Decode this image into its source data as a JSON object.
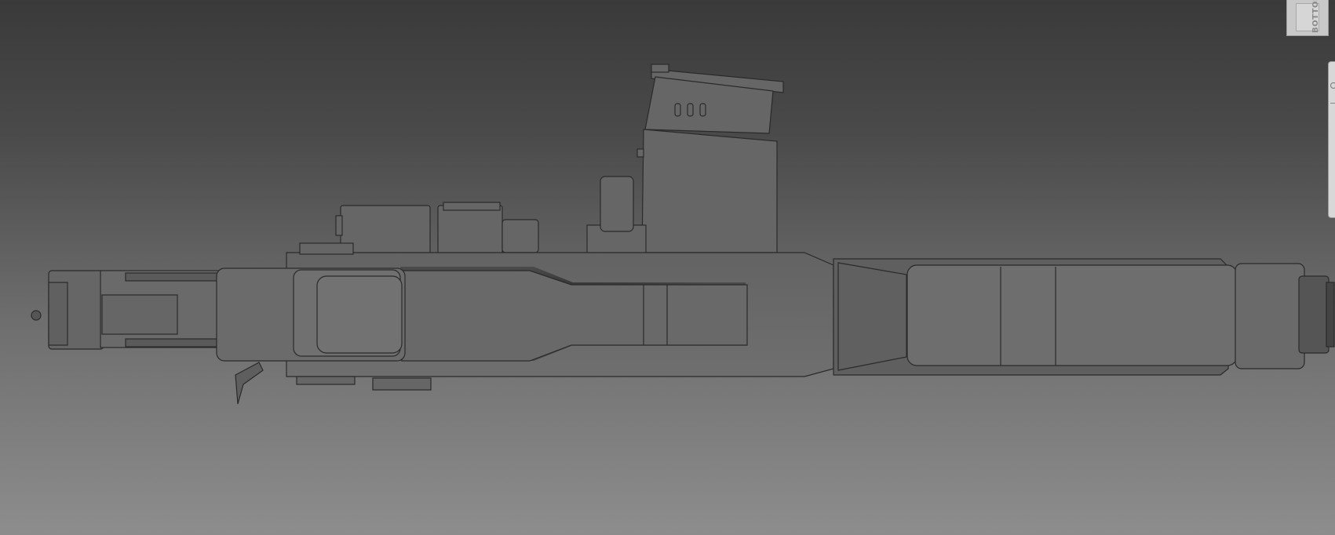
{
  "viewport": {
    "background_top": "#3a3a3a",
    "background_bottom": "#8d8d8d",
    "model_color": "#6b6b6b",
    "edge_color": "#2a2a2a"
  },
  "viewcube": {
    "face_label": "BOTTOM",
    "icon": "viewcube-icon"
  },
  "navigation_bar": {
    "icon": "navigation-bar-icon"
  }
}
